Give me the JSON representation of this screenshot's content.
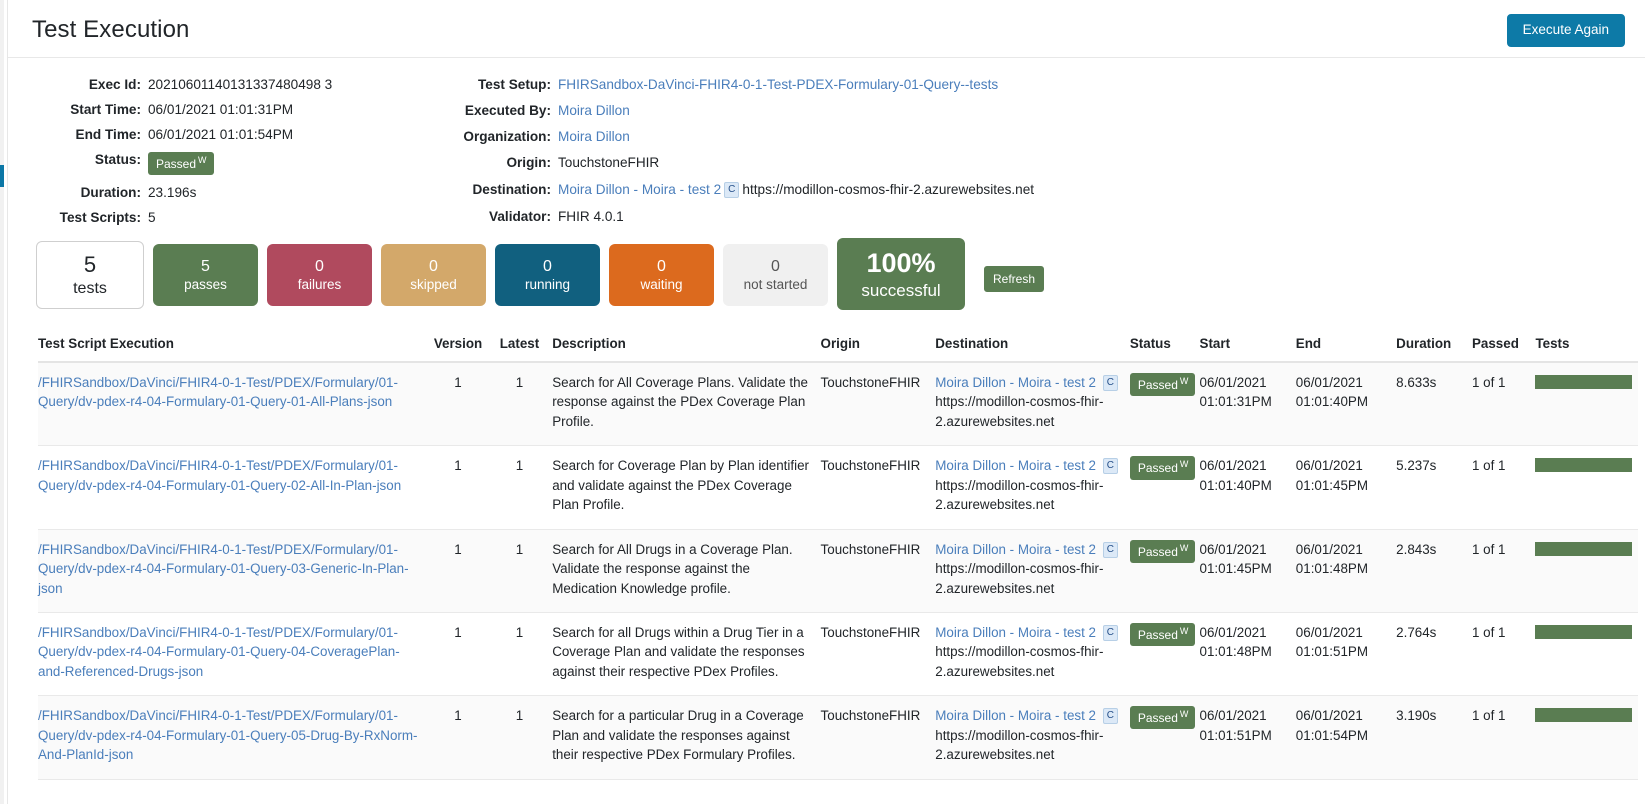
{
  "header": {
    "title": "Test Execution",
    "execute_again_label": "Execute Again"
  },
  "details": {
    "left": [
      {
        "label": "Exec Id:",
        "value": "20210601140131337480498 3"
      },
      {
        "label": "Start Time:",
        "value": "06/01/2021 01:01:31PM"
      },
      {
        "label": "End Time:",
        "value": "06/01/2021 01:01:54PM"
      },
      {
        "label": "Status:",
        "value": "Passed",
        "badge_sup": "W"
      },
      {
        "label": "Duration:",
        "value": "23.196s"
      },
      {
        "label": "Test Scripts:",
        "value": "5"
      }
    ],
    "exec_id_value": "20210601140131337480498 3",
    "right": [
      {
        "label": "Test Setup:",
        "value": "FHIRSandbox-DaVinci-FHIR4-0-1-Test-PDEX-Formulary-01-Query--tests"
      },
      {
        "label": "Executed By:",
        "value": "Moira Dillon"
      },
      {
        "label": "Organization:",
        "value": "Moira Dillon"
      },
      {
        "label": "Origin:",
        "value": "TouchstoneFHIR"
      },
      {
        "label": "Destination:",
        "value": "Moira Dillon - Moira - test 2"
      },
      {
        "label": "Validator:",
        "value": "FHIR 4.0.1"
      }
    ],
    "destination_tag": "C",
    "destination_url": "https://modillon-cosmos-fhir-2.azurewebsites.net"
  },
  "stats": {
    "tests": {
      "num": "5",
      "label": "tests"
    },
    "passes": {
      "num": "5",
      "label": "passes"
    },
    "failures": {
      "num": "0",
      "label": "failures"
    },
    "skipped": {
      "num": "0",
      "label": "skipped"
    },
    "running": {
      "num": "0",
      "label": "running"
    },
    "waiting": {
      "num": "0",
      "label": "waiting"
    },
    "not_started": {
      "num": "0",
      "label": "not started"
    },
    "percent": {
      "num": "100%",
      "label": "successful"
    },
    "refresh_label": "Refresh",
    "colors": {
      "passes": "#5a7d52",
      "failures": "#b04a5e",
      "skipped": "#d3a86a",
      "running": "#11607f",
      "waiting": "#dc6a1e",
      "not_started": "#f0f0f0",
      "percent": "#5a7d52",
      "accent": "#0d7aa7",
      "link": "#4a7ebb"
    }
  },
  "table": {
    "columns": [
      "Test Script Execution",
      "Version",
      "Latest",
      "Description",
      "Origin",
      "Destination",
      "Status",
      "Start",
      "End",
      "Duration",
      "Passed",
      "Tests"
    ],
    "dest_tag": "C",
    "dest_url": "https://modillon-cosmos-fhir-2.azurewebsites.net",
    "rows": [
      {
        "script": "/FHIRSandbox/DaVinci/FHIR4-0-1-Test/PDEX/Formulary/01-Query/dv-pdex-r4-04-Formulary-01-Query-01-All-Plans-json",
        "version": "1",
        "latest": "1",
        "description": "Search for All Coverage Plans. Validate the response against the PDex Coverage Plan Profile.",
        "origin": "TouchstoneFHIR",
        "destination": "Moira Dillon - Moira - test 2",
        "status": "Passed",
        "status_sup": "W",
        "start_date": "06/01/2021",
        "start_time": "01:01:31PM",
        "end_date": "06/01/2021",
        "end_time": "01:01:40PM",
        "duration": "8.633s",
        "passed": "1 of 1"
      },
      {
        "script": "/FHIRSandbox/DaVinci/FHIR4-0-1-Test/PDEX/Formulary/01-Query/dv-pdex-r4-04-Formulary-01-Query-02-All-In-Plan-json",
        "version": "1",
        "latest": "1",
        "description": "Search for Coverage Plan by Plan identifier and validate against the PDex Coverage Plan Profile.",
        "origin": "TouchstoneFHIR",
        "destination": "Moira Dillon - Moira - test 2",
        "status": "Passed",
        "status_sup": "W",
        "start_date": "06/01/2021",
        "start_time": "01:01:40PM",
        "end_date": "06/01/2021",
        "end_time": "01:01:45PM",
        "duration": "5.237s",
        "passed": "1 of 1"
      },
      {
        "script": "/FHIRSandbox/DaVinci/FHIR4-0-1-Test/PDEX/Formulary/01-Query/dv-pdex-r4-04-Formulary-01-Query-03-Generic-In-Plan-json",
        "version": "1",
        "latest": "1",
        "description": "Search for All Drugs in a Coverage Plan. Validate the response against the Medication Knowledge profile.",
        "origin": "TouchstoneFHIR",
        "destination": "Moira Dillon - Moira - test 2",
        "status": "Passed",
        "status_sup": "W",
        "start_date": "06/01/2021",
        "start_time": "01:01:45PM",
        "end_date": "06/01/2021",
        "end_time": "01:01:48PM",
        "duration": "2.843s",
        "passed": "1 of 1"
      },
      {
        "script": "/FHIRSandbox/DaVinci/FHIR4-0-1-Test/PDEX/Formulary/01-Query/dv-pdex-r4-04-Formulary-01-Query-04-CoveragePlan-and-Referenced-Drugs-json",
        "version": "1",
        "latest": "1",
        "description": "Search for all Drugs within a Drug Tier in a Coverage Plan and validate the responses against their respective PDex Profiles.",
        "origin": "TouchstoneFHIR",
        "destination": "Moira Dillon - Moira - test 2",
        "status": "Passed",
        "status_sup": "W",
        "start_date": "06/01/2021",
        "start_time": "01:01:48PM",
        "end_date": "06/01/2021",
        "end_time": "01:01:51PM",
        "duration": "2.764s",
        "passed": "1 of 1"
      },
      {
        "script": "/FHIRSandbox/DaVinci/FHIR4-0-1-Test/PDEX/Formulary/01-Query/dv-pdex-r4-04-Formulary-01-Query-05-Drug-By-RxNorm-And-PlanId-json",
        "version": "1",
        "latest": "1",
        "description": "Search for a particular Drug in a Coverage Plan and validate the responses against their respective PDex Formulary Profiles.",
        "origin": "TouchstoneFHIR",
        "destination": "Moira Dillon - Moira - test 2",
        "status": "Passed",
        "status_sup": "W",
        "start_date": "06/01/2021",
        "start_time": "01:01:51PM",
        "end_date": "06/01/2021",
        "end_time": "01:01:54PM",
        "duration": "3.190s",
        "passed": "1 of 1"
      }
    ]
  }
}
